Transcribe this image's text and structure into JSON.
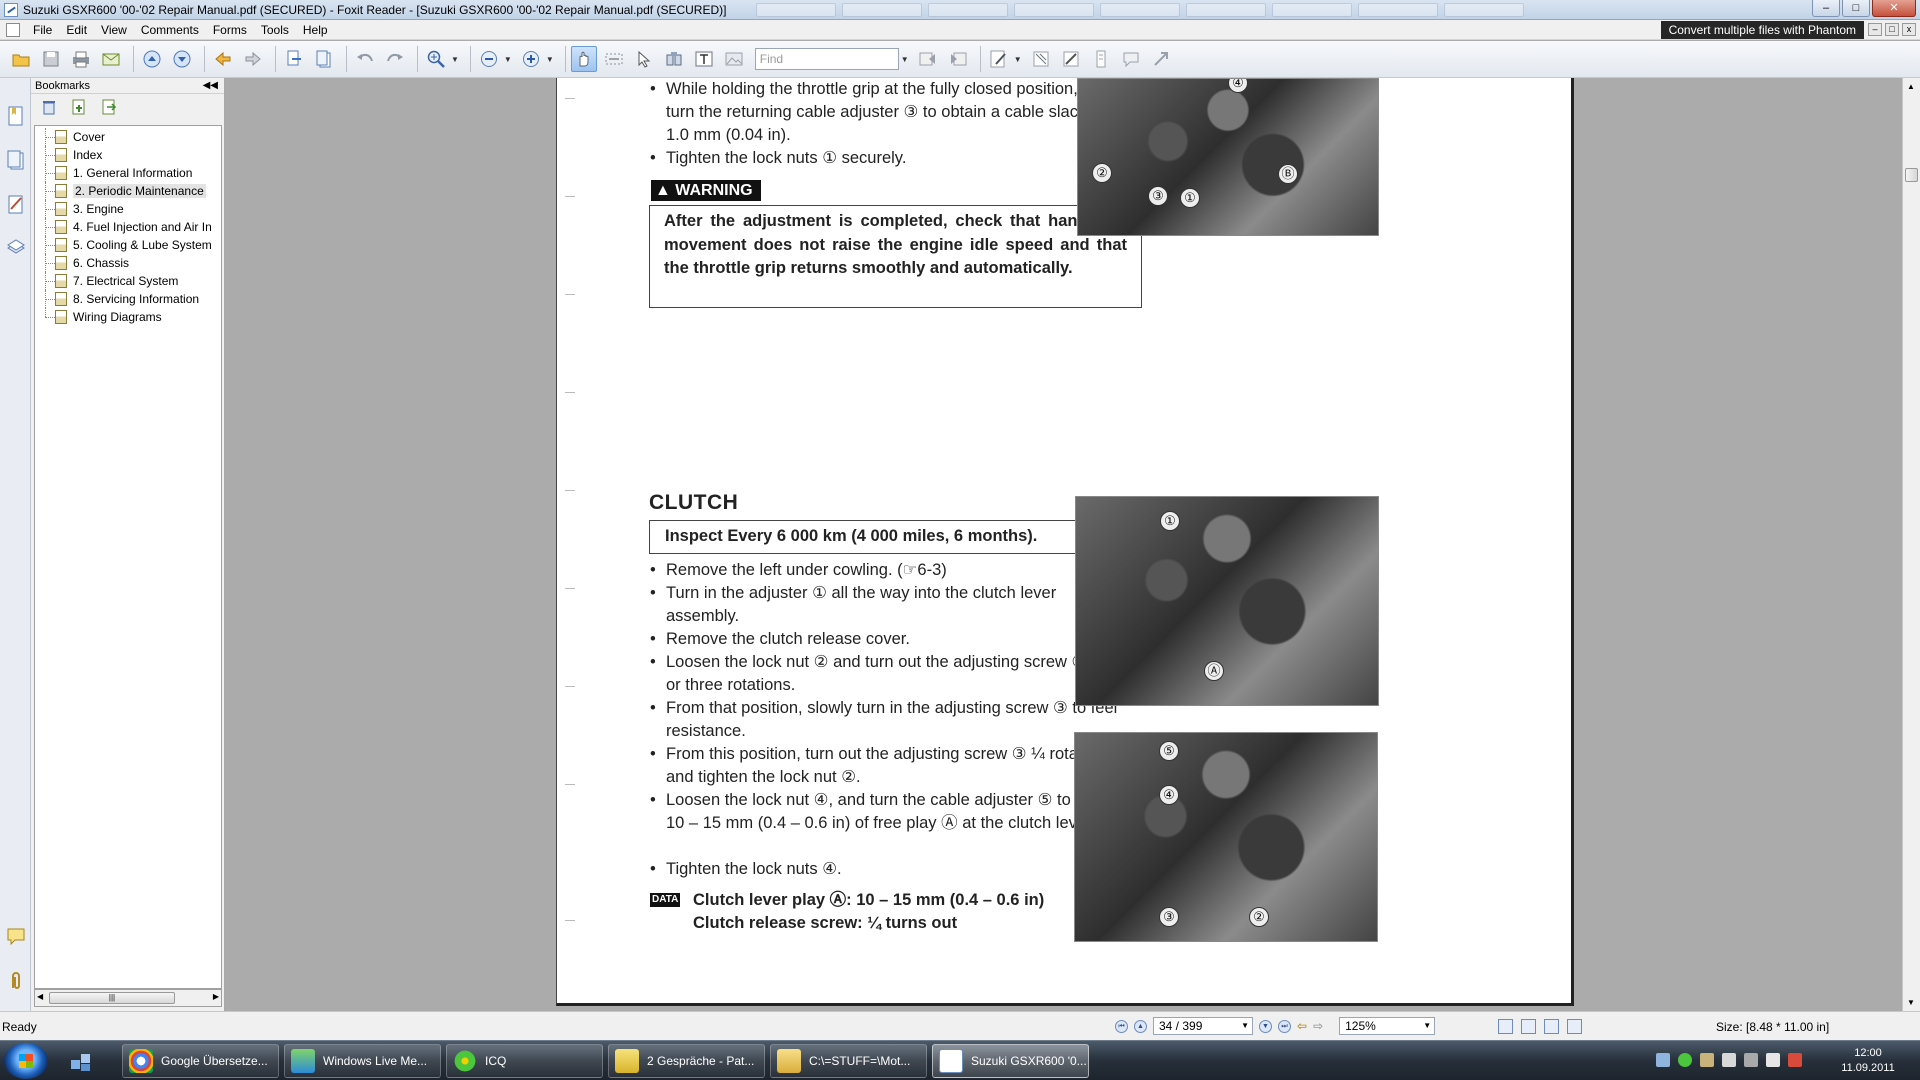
{
  "window": {
    "title": "Suzuki GSXR600 '00-'02 Repair Manual.pdf (SECURED) - Foxit Reader - [Suzuki GSXR600 '00-'02 Repair Manual.pdf (SECURED)]",
    "controls": [
      "–",
      "□",
      "✕"
    ]
  },
  "menu": {
    "items": [
      "File",
      "Edit",
      "View",
      "Comments",
      "Forms",
      "Tools",
      "Help"
    ],
    "banner": "Convert multiple files with Phantom"
  },
  "toolbar": {
    "find_placeholder": "Find",
    "icons": [
      "open-icon",
      "save-icon",
      "print-icon",
      "email-icon",
      "prev-page-icon",
      "next-page-icon",
      "back-icon",
      "forward-icon",
      "extract-page-icon",
      "insert-page-icon",
      "undo-icon",
      "redo-icon",
      "zoom-in-icon",
      "zoom-out-icon",
      "zoom-plus-icon",
      "hand-tool-icon",
      "select-text-icon",
      "select-icon",
      "snapshot-icon",
      "typewriter-icon",
      "image-icon",
      "find-prev-icon",
      "find-next-icon",
      "pen-icon",
      "eraser-icon",
      "note-icon",
      "stamp-icon",
      "comment-icon",
      "arrow-icon"
    ]
  },
  "bookmarks": {
    "title": "Bookmarks",
    "items": [
      "Cover",
      "Index",
      "1. General Information",
      "2. Periodic Maintenance",
      "3. Engine",
      "4. Fuel Injection and Air In",
      "5. Cooling & Lube System",
      "6. Chassis",
      "7. Electrical System",
      "8. Servicing Information",
      "Wiring Diagrams"
    ],
    "selected_index": 3
  },
  "page": {
    "top_bullets": [
      "While holding the throttle grip at the fully closed position, slowly turn the returning cable adjuster ③ to obtain a cable slack Ⓑ of 1.0 mm (0.04 in).",
      "Tighten the lock nuts ① securely."
    ],
    "warning_label": "WARNING",
    "warning_text": "After the adjustment is completed, check that handlebar movement does not raise the engine idle speed and that the throttle grip returns smoothly and automatically.",
    "section_title": "CLUTCH",
    "inspect_text": "Inspect Every 6 000 km (4 000 miles, 6 months).",
    "clutch_bullets": [
      "Remove the left under cowling. (☞6-3)",
      "Turn in the adjuster ① all the way into the clutch lever assembly.",
      "Remove the clutch release cover.",
      "Loosen the lock nut ② and turn out the adjusting screw ③ two or three rotations.",
      "From that position, slowly turn in the adjusting screw ③ to feel resistance.",
      "From this position, turn out the adjusting screw ③ ¼ rotations, and tighten the lock nut ②.",
      "Loosen the lock nut ④, and turn the cable adjuster ⑤ to obtain 10 – 15 mm (0.4 – 0.6 in) of free play Ⓐ at the clutch lever end.",
      "Tighten the lock nuts ④."
    ],
    "data_icon": "DATA",
    "spec_1": "Clutch lever play Ⓐ: 10 – 15 mm (0.4 – 0.6 in)",
    "spec_2": "Clutch release screw: ¼ turns out",
    "photo_labels": {
      "top": [
        "②",
        "③",
        "①",
        "Ⓑ",
        "④"
      ],
      "middle": [
        "①",
        "Ⓐ"
      ],
      "bottom": [
        "⑤",
        "④",
        "③",
        "②"
      ]
    }
  },
  "status": {
    "ready": "Ready",
    "page_indicator": "34 / 399",
    "zoom": "125%",
    "size": "Size: [8.48 * 11.00 in]"
  },
  "taskbar": {
    "tasks": [
      "Google Übersetze...",
      "Windows Live Me...",
      "ICQ",
      "2 Gespräche - Pat...",
      "C:\\=STUFF=\\Mot...",
      "Suzuki GSXR600 '0..."
    ],
    "active_task_index": 5,
    "time": "12:00",
    "date": "11.09.2011"
  },
  "colors": {
    "titlebar": "#c2d3e8",
    "banner_bg": "#262626",
    "taskbar": "#27303b",
    "workspace": "#ababab"
  }
}
